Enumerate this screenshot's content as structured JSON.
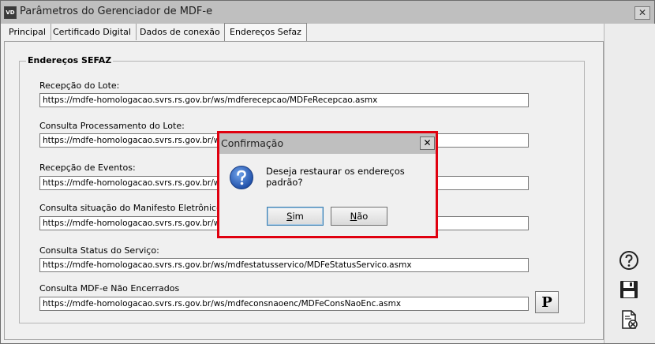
{
  "window": {
    "app_icon_text": "VD",
    "title": "Parâmetros do Gerenciador de MDF-e",
    "close_glyph": "✕"
  },
  "tabs": [
    {
      "label": "Principal",
      "active": false
    },
    {
      "label": "Certificado Digital",
      "active": false
    },
    {
      "label": "Dados de conexão",
      "active": false
    },
    {
      "label": "Endereços Sefaz",
      "active": true
    }
  ],
  "group": {
    "title": "Endereços SEFAZ",
    "fields": [
      {
        "label": "Recepção do Lote:",
        "value": "https://mdfe-homologacao.svrs.rs.gov.br/ws/mdferecepcao/MDFeRecepcao.asmx"
      },
      {
        "label": "Consulta Processamento do Lote:",
        "value": "https://mdfe-homologacao.svrs.rs.gov.br/ws/"
      },
      {
        "label": "Recepção de Eventos:",
        "value": "https://mdfe-homologacao.svrs.rs.gov.br/ws/"
      },
      {
        "label": "Consulta situação do Manifesto Eletrônico de D",
        "value": "https://mdfe-homologacao.svrs.rs.gov.br/ws/"
      },
      {
        "label": "Consulta Status do Serviço:",
        "value": "https://mdfe-homologacao.svrs.rs.gov.br/ws/mdfestatusservico/MDFeStatusServico.asmx"
      },
      {
        "label": "Consulta MDF-e Não Encerrados",
        "value": "https://mdfe-homologacao.svrs.rs.gov.br/ws/mdfeconsnaoenc/MDFeConsNaoEnc.asmx"
      }
    ],
    "p_button_label": "P"
  },
  "sidebar": {
    "icons": [
      "help-icon",
      "save-icon",
      "cancel-document-icon"
    ]
  },
  "dialog": {
    "title": "Confirmação",
    "close_glyph": "✕",
    "icon": "question-icon",
    "message": "Deseja restaurar os endereços padrão?",
    "yes_label": "im",
    "yes_mnemonic": "S",
    "no_label": "ão",
    "no_mnemonic": "N"
  },
  "colors": {
    "highlight": "#e0000f",
    "question_blue": "#1f4fa8"
  }
}
